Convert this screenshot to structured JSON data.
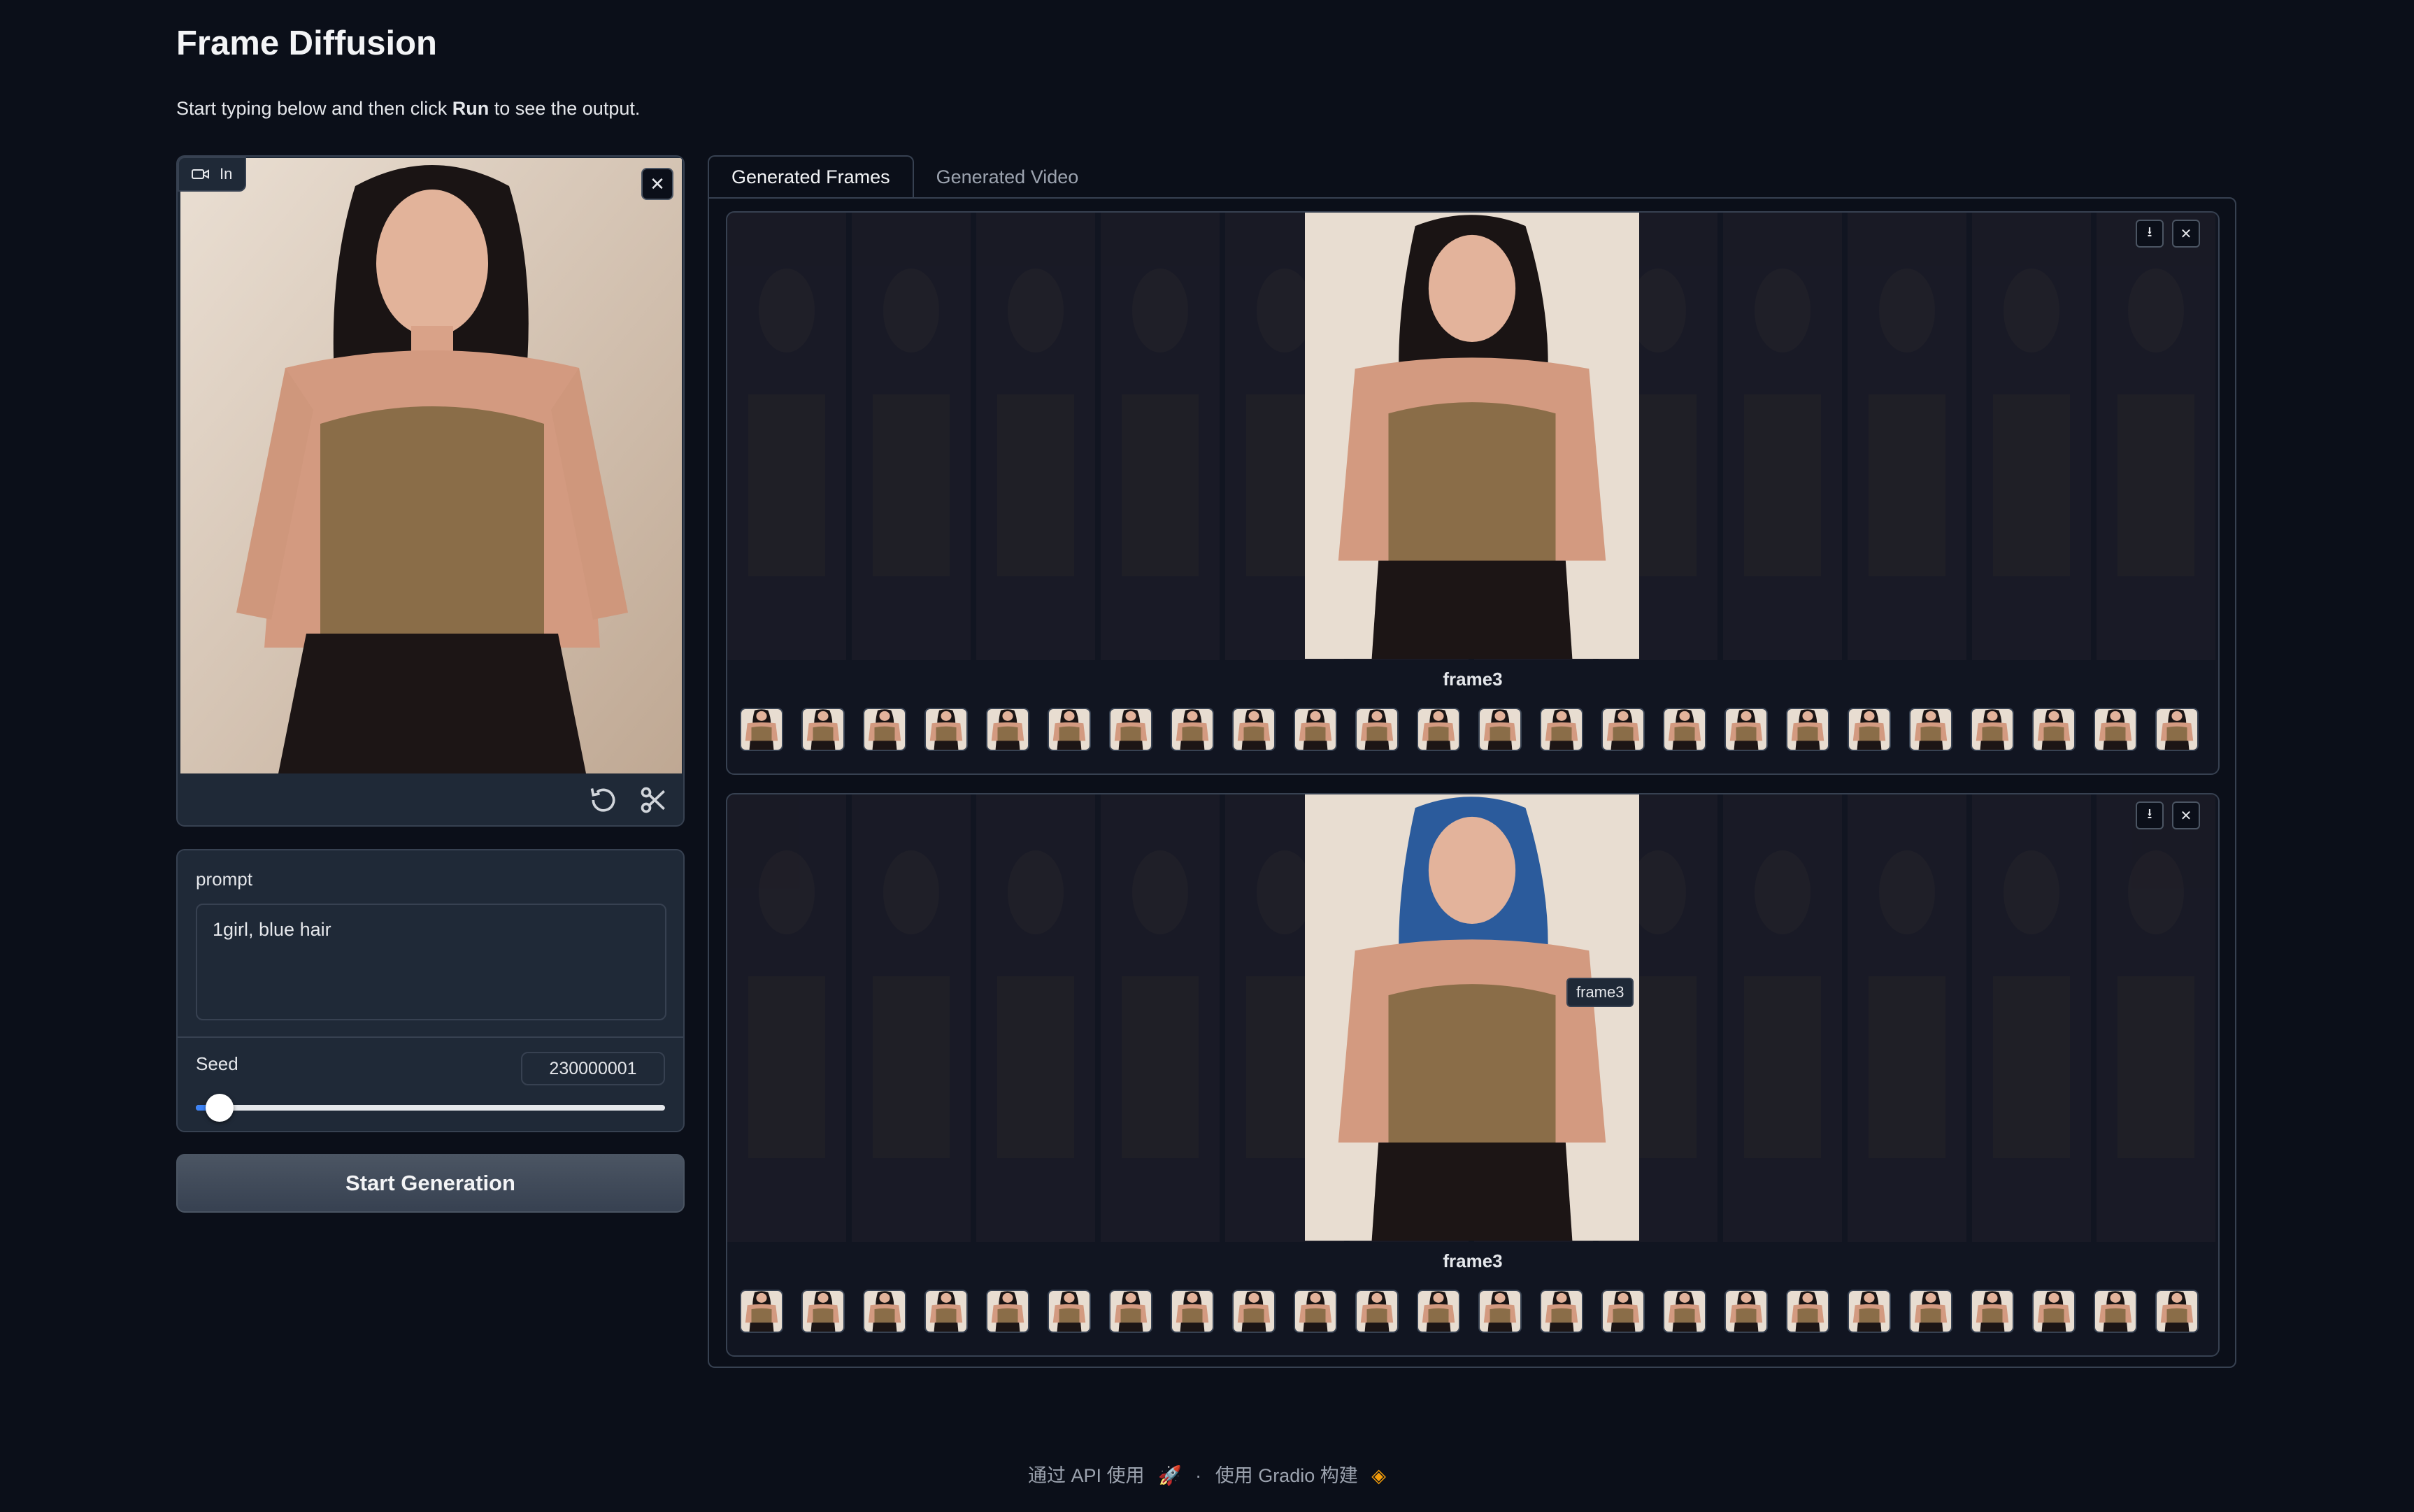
{
  "app": {
    "title": "Frame Diffusion",
    "subtitle_pre": "Start typing below and then click ",
    "subtitle_bold": "Run",
    "subtitle_post": " to see the output."
  },
  "input_image": {
    "label": "In",
    "close_icon": "close-icon",
    "toolbar": [
      "undo-icon",
      "scissors-icon"
    ]
  },
  "form": {
    "prompt_label": "prompt",
    "prompt_value": "1girl, blue hair",
    "seed_label": "Seed",
    "seed_value": "230000001",
    "seed_slider_fraction": 0.05
  },
  "start_button": "Start Generation",
  "tabs": [
    {
      "label": "Generated Frames",
      "active": true
    },
    {
      "label": "Generated Video",
      "active": false
    }
  ],
  "galleries": [
    {
      "caption": "frame3",
      "hair": "#1a1414",
      "thumb_count": 24
    },
    {
      "caption": "frame3",
      "hair": "#2b5b9c",
      "thumb_count": 24
    }
  ],
  "tooltip": "frame3",
  "footer": {
    "api": "通过 API 使用",
    "sep": "·",
    "built": "使用 Gradio 构建"
  },
  "colors": {
    "background": "#0b0f19",
    "panel": "#1f2937",
    "border": "#374151",
    "accent": "#3b82f6"
  }
}
